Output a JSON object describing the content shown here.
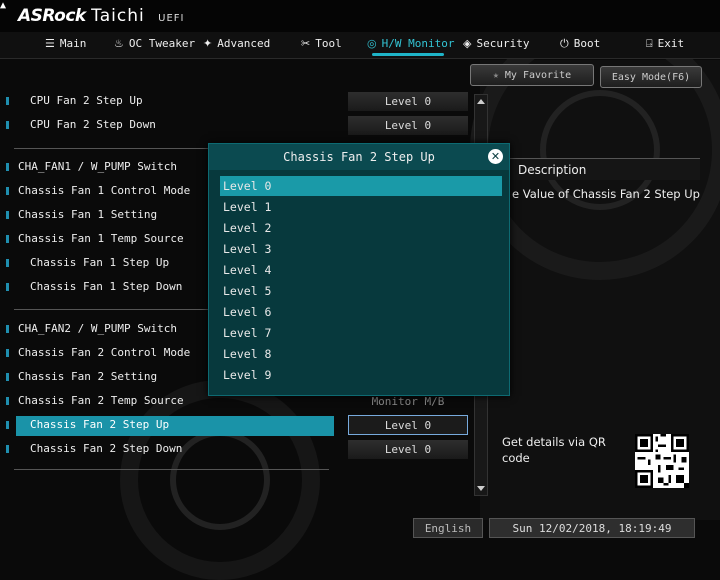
{
  "brand": {
    "name": "ASRock",
    "model": "Taichi",
    "firmware": "UEFI"
  },
  "nav": [
    {
      "label": "Main",
      "icon": "list-icon",
      "glyph": "☰"
    },
    {
      "label": "OC Tweaker",
      "icon": "flame-icon",
      "glyph": "♨"
    },
    {
      "label": "Advanced",
      "icon": "star-icon",
      "glyph": "✦"
    },
    {
      "label": "Tool",
      "icon": "tools-icon",
      "glyph": "✂"
    },
    {
      "label": "H/W Monitor",
      "icon": "monitor-icon",
      "glyph": "◎",
      "active": true
    },
    {
      "label": "Security",
      "icon": "shield-icon",
      "glyph": "◈"
    },
    {
      "label": "Boot",
      "icon": "power-icon",
      "glyph": "⏻"
    },
    {
      "label": "Exit",
      "icon": "exit-icon",
      "glyph": "⍈"
    }
  ],
  "favorite_label": "My Favorite",
  "easy_mode_label": "Easy Mode(F6)",
  "settings": [
    {
      "label": "CPU Fan 2 Step Up",
      "value": "Level 0",
      "indent": true
    },
    {
      "label": "CPU Fan 2 Step Down",
      "value": "Level 0",
      "indent": true
    },
    {
      "label": "CHA_FAN1 / W_PUMP Switch",
      "value": ""
    },
    {
      "label": "Chassis Fan 1 Control Mode",
      "value": ""
    },
    {
      "label": "Chassis Fan 1 Setting",
      "value": ""
    },
    {
      "label": "Chassis Fan 1 Temp Source",
      "value": ""
    },
    {
      "label": "Chassis Fan 1 Step Up",
      "value": "",
      "indent": true
    },
    {
      "label": "Chassis Fan 1 Step Down",
      "value": "",
      "indent": true
    },
    {
      "label": "CHA_FAN2 / W_PUMP Switch",
      "value": ""
    },
    {
      "label": "Chassis Fan 2 Control Mode",
      "value": ""
    },
    {
      "label": "Chassis Fan 2 Setting",
      "value": ""
    },
    {
      "label": "Chassis Fan 2 Temp Source",
      "value": "Monitor M/B"
    },
    {
      "label": "Chassis Fan 2 Step Up",
      "value": "Level 0",
      "indent": true,
      "selected": true
    },
    {
      "label": "Chassis Fan 2 Step Down",
      "value": "Level 0",
      "indent": true
    }
  ],
  "description": {
    "title": "Description",
    "text": "e Value of Chassis Fan 2 Step Up"
  },
  "qr_label": "Get details via QR code",
  "popup": {
    "title": "Chassis Fan 2 Step Up",
    "options": [
      "Level 0",
      "Level 1",
      "Level 2",
      "Level 3",
      "Level 4",
      "Level 5",
      "Level 6",
      "Level 7",
      "Level 8",
      "Level 9"
    ],
    "selected_index": 0
  },
  "footer": {
    "language": "English",
    "datetime": "Sun 12/02/2018, 18:19:49"
  },
  "colors": {
    "accent": "#1a9aa8",
    "popup_bg": "#07393d",
    "bullet": "#1f8fb0"
  }
}
